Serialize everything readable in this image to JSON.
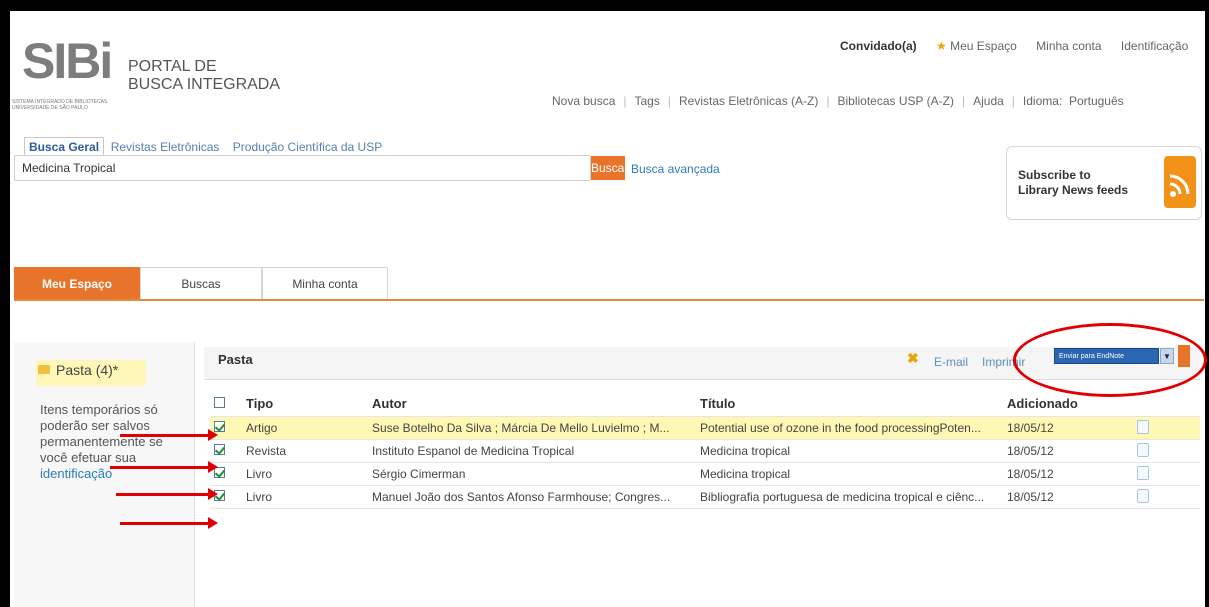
{
  "logo": {
    "word": "SIBi",
    "title_line1": "PORTAL DE",
    "title_line2": "BUSCA INTEGRADA",
    "sub_line1": "SISTEMA INTEGRADO DE BIBLIOTECAS",
    "sub_line2": "UNIVERSIDADE DE SÃO PAULO"
  },
  "toplinks": {
    "user": "Convidado(a)",
    "meu_espaco": "Meu Espaço",
    "minha_conta": "Minha conta",
    "identificacao": "Identificação"
  },
  "nav": [
    "Nova busca",
    "Tags",
    "Revistas Eletrônicas (A-Z)",
    "Bibliotecas USP (A-Z)",
    "Ajuda",
    "Idioma:",
    "Português"
  ],
  "search": {
    "tabs": [
      "Busca Geral",
      "Revistas Eletrônicas",
      "Produção Científica da USP"
    ],
    "value": "Medicina Tropical",
    "button": "Buscar",
    "advanced": "Busca avançada"
  },
  "rss": {
    "line1": "Subscribe to",
    "line2": "Library News feeds"
  },
  "main_tabs": [
    "Meu Espaço",
    "Buscas",
    "Minha conta"
  ],
  "left": {
    "folder": "Pasta (4)*",
    "note_before": "Itens temporários só poderão ser salvos permanentemente se você efetuar sua ",
    "note_link": "identificação"
  },
  "results": {
    "title": "Pasta",
    "email": "E-mail",
    "print": "Imprimir",
    "export_select": "Enviar para EndNote",
    "columns": {
      "tipo": "Tipo",
      "autor": "Autor",
      "titulo": "Título",
      "adicionado": "Adicionado"
    },
    "rows": [
      {
        "tipo": "Artigo",
        "autor": "Suse Botelho Da Silva ; Márcia De Mello Luvielmo ; M...",
        "titulo": "Potential use of ozone in the food processingPoten...",
        "adicionado": "18/05/12",
        "highlighted": true,
        "checked": true
      },
      {
        "tipo": "Revista",
        "autor": "Instituto Espanol de Medicina Tropical",
        "titulo": "Medicina tropical",
        "adicionado": "18/05/12",
        "highlighted": false,
        "checked": true
      },
      {
        "tipo": "Livro",
        "autor": "Sérgio Cimerman",
        "titulo": "Medicina tropical",
        "adicionado": "18/05/12",
        "highlighted": false,
        "checked": true
      },
      {
        "tipo": "Livro",
        "autor": "Manuel João dos Santos Afonso Farmhouse; Congres...",
        "titulo": "Bibliografia portuguesa de medicina tropical e ciênc...",
        "adicionado": "18/05/12",
        "highlighted": false,
        "checked": true
      }
    ]
  },
  "colors": {
    "accent": "#e8742c",
    "link": "#2e7bbd",
    "highlight": "#fff8b5",
    "annotation": "#e00000"
  }
}
